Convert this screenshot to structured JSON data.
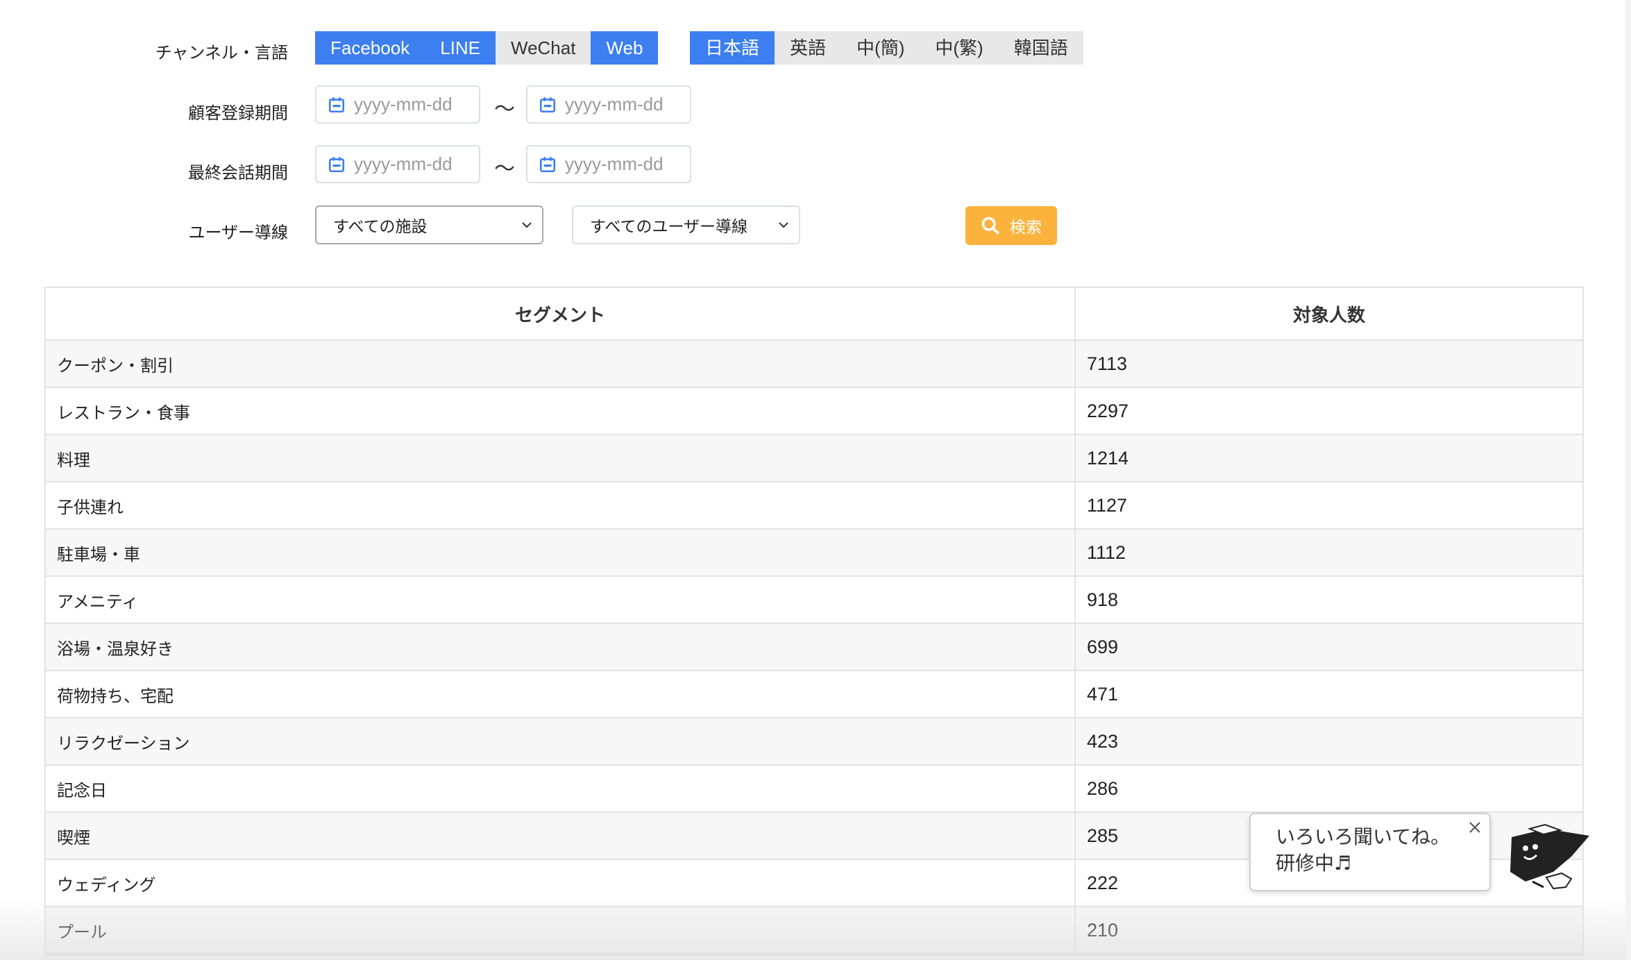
{
  "filters": {
    "channel_label": "チャンネル・言語",
    "channels": [
      {
        "label": "Facebook",
        "active": true
      },
      {
        "label": "LINE",
        "active": true
      },
      {
        "label": "WeChat",
        "active": false
      },
      {
        "label": "Web",
        "active": true
      }
    ],
    "languages": [
      {
        "label": "日本語",
        "active": true
      },
      {
        "label": "英語",
        "active": false
      },
      {
        "label": "中(簡)",
        "active": false
      },
      {
        "label": "中(繁)",
        "active": false
      },
      {
        "label": "韓国語",
        "active": false
      }
    ],
    "register_label": "顧客登録期間",
    "last_talk_label": "最終会話期間",
    "date_placeholder": "yyyy-mm-dd",
    "range_separator": "〜",
    "flow_label": "ユーザー導線",
    "facility_select": "すべての施設",
    "flow_select": "すべてのユーザー導線",
    "search_label": "検索"
  },
  "table": {
    "headers": [
      "セグメント",
      "対象人数"
    ],
    "rows": [
      [
        "クーポン・割引",
        "7113"
      ],
      [
        "レストラン・食事",
        "2297"
      ],
      [
        "料理",
        "1214"
      ],
      [
        "子供連れ",
        "1127"
      ],
      [
        "駐車場・車",
        "1112"
      ],
      [
        "アメニティ",
        "918"
      ],
      [
        "浴場・温泉好き",
        "699"
      ],
      [
        "荷物持ち、宅配",
        "471"
      ],
      [
        "リラクゼーション",
        "423"
      ],
      [
        "記念日",
        "286"
      ],
      [
        "喫煙",
        "285"
      ],
      [
        "ウェディング",
        "222"
      ],
      [
        "プール",
        "210"
      ]
    ]
  },
  "chat": {
    "line1": "いろいろ聞いてね。",
    "line2": "研修中♬"
  },
  "colors": {
    "active_toggle": "#3d7ef0",
    "search_button": "#fbb33d"
  }
}
